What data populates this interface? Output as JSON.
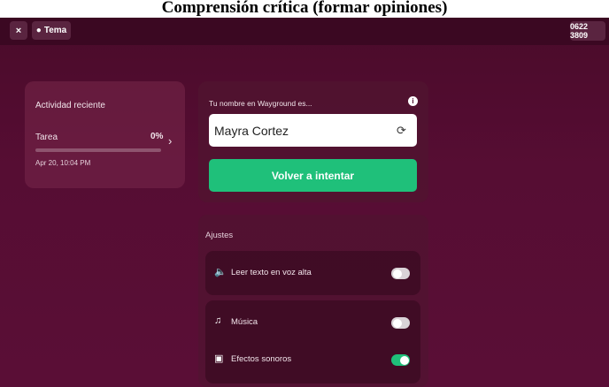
{
  "document": {
    "title": "Comprensión crítica (formar opiniones)"
  },
  "topbar": {
    "close_label": "×",
    "theme_label": "Tema",
    "code": "0622 3809"
  },
  "activity": {
    "heading": "Actividad reciente",
    "task_label": "Tarea",
    "progress_label": "0%",
    "progress_value": 0,
    "date": "Apr 20, 10:04 PM"
  },
  "name_card": {
    "label": "Tu nombre en Wayground es...",
    "name_value": "Mayra Cortez",
    "retry_label": "Volver a intentar"
  },
  "settings": {
    "title": "Ajustes",
    "items": [
      {
        "label": "Leer texto en voz alta",
        "icon": "speaker-icon",
        "enabled": false
      },
      {
        "label": "Música",
        "icon": "music-icon",
        "enabled": false
      },
      {
        "label": "Efectos sonoros",
        "icon": "sound-effects-icon",
        "enabled": true
      }
    ]
  },
  "colors": {
    "background": "#560d33",
    "accent_green": "#1fc07a"
  }
}
